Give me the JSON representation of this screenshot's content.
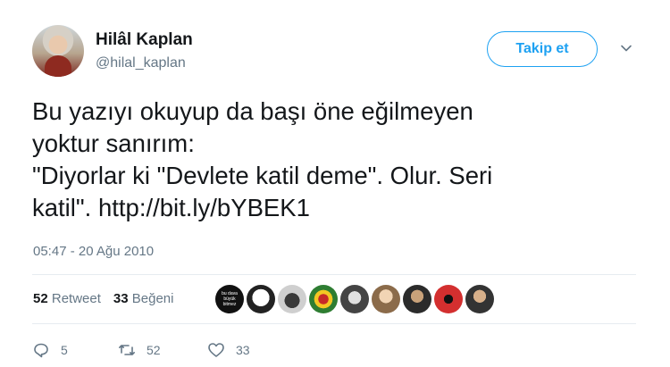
{
  "user": {
    "name": "Hilâl Kaplan",
    "handle": "@hilal_kaplan"
  },
  "follow_button": {
    "label": "Takip et"
  },
  "tweet": {
    "text_lines": [
      "Bu yazıyı okuyup da başı öne eğilmeyen",
      "yoktur sanırım:",
      "\"Diyorlar ki \"Devlete katil deme\". Olur. Seri",
      "katil\". "
    ],
    "link": "http://bit.ly/bYBEK1",
    "timestamp": "05:47 - 20 Ağu 2010"
  },
  "stats": {
    "retweets_count": "52",
    "retweets_label": "Retweet",
    "likes_count": "33",
    "likes_label": "Beğeni"
  },
  "liker_avatars": [
    {
      "label_text": "bu dava büyük bitmez"
    },
    {
      "label_text": ""
    },
    {
      "label_text": ""
    },
    {
      "label_text": ""
    },
    {
      "label_text": ""
    },
    {
      "label_text": ""
    },
    {
      "label_text": ""
    },
    {
      "label_text": ""
    },
    {
      "label_text": ""
    }
  ],
  "actions": {
    "replies": "5",
    "retweets": "52",
    "likes": "33"
  },
  "colors": {
    "accent": "#1da1f2",
    "secondary_text": "#657786",
    "divider": "#e6ecf0"
  },
  "icons": [
    "chevron-down-icon",
    "reply-icon",
    "retweet-icon",
    "heart-icon"
  ]
}
